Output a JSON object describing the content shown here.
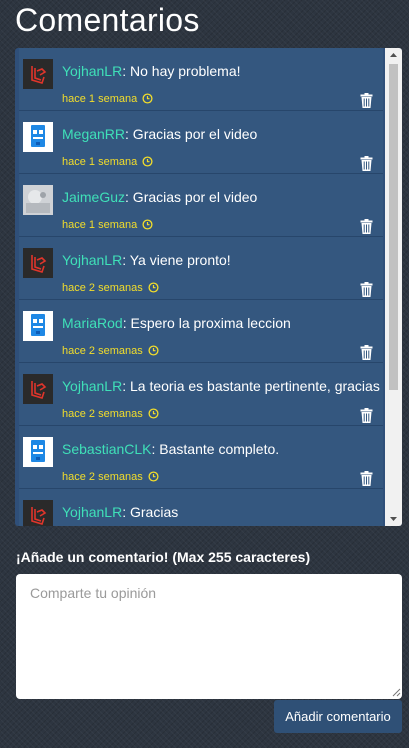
{
  "header": {
    "title": "Comentarios"
  },
  "comments": [
    {
      "user": "YojhanLR",
      "text": ": No hay problema!",
      "time": "hace 1 semana",
      "avatar": "laravel-logo-avatar"
    },
    {
      "user": "MeganRR",
      "text": ": Gracias por el video",
      "time": "hace 1 semana",
      "avatar": "robot-avatar"
    },
    {
      "user": "JaimeGuz",
      "text": ": Gracias por el video",
      "time": "hace 1 semana",
      "avatar": "photo-avatar"
    },
    {
      "user": "YojhanLR",
      "text": ": Ya viene pronto!",
      "time": "hace 2 semanas",
      "avatar": "laravel-logo-avatar"
    },
    {
      "user": "MariaRod",
      "text": ": Espero la proxima leccion",
      "time": "hace 2 semanas",
      "avatar": "robot-avatar"
    },
    {
      "user": "YojhanLR",
      "text": ": La teoria es bastante pertinente, gracias",
      "time": "hace 2 semanas",
      "avatar": "laravel-logo-avatar"
    },
    {
      "user": "SebastianCLK",
      "text": ": Bastante completo.",
      "time": "hace 2 semanas",
      "avatar": "robot-avatar"
    },
    {
      "user": "YojhanLR",
      "text": ": Gracias",
      "time": "",
      "avatar": "laravel-logo-avatar"
    }
  ],
  "form": {
    "label": "¡Añade un comentario! (Max 255 caracteres)",
    "placeholder": "Comparte tu opinión",
    "submit_label": "Añadir comentario"
  },
  "colors": {
    "username": "#3fe0b8",
    "timestamp": "#f2dd2b",
    "panel": "#34577f",
    "button": "#2f5076"
  }
}
